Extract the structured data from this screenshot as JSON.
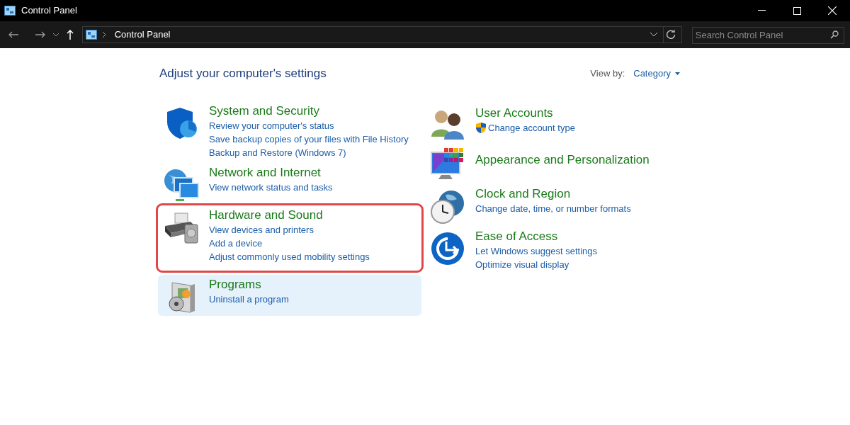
{
  "window": {
    "title": "Control Panel"
  },
  "address_bar": {
    "path": "Control Panel"
  },
  "search": {
    "placeholder": "Search Control Panel"
  },
  "heading": "Adjust your computer's settings",
  "view_by": {
    "label": "View by:",
    "value": "Category"
  },
  "columns": [
    {
      "categories": [
        {
          "kind": "security",
          "title": "System and Security",
          "highlighted": false,
          "hovered": false,
          "links": [
            {
              "text": "Review your computer's status"
            },
            {
              "text": "Save backup copies of your files with File History"
            },
            {
              "text": "Backup and Restore (Windows 7)"
            }
          ]
        },
        {
          "kind": "network",
          "title": "Network and Internet",
          "highlighted": false,
          "hovered": false,
          "links": [
            {
              "text": "View network status and tasks"
            }
          ]
        },
        {
          "kind": "hardware",
          "title": "Hardware and Sound",
          "highlighted": true,
          "hovered": false,
          "links": [
            {
              "text": "View devices and printers"
            },
            {
              "text": "Add a device"
            },
            {
              "text": "Adjust commonly used mobility settings"
            }
          ]
        },
        {
          "kind": "programs",
          "title": "Programs",
          "highlighted": false,
          "hovered": true,
          "links": [
            {
              "text": "Uninstall a program"
            }
          ]
        }
      ]
    },
    {
      "categories": [
        {
          "kind": "users",
          "title": "User Accounts",
          "highlighted": false,
          "hovered": false,
          "links": [
            {
              "text": "Change account type",
              "shield": true
            }
          ]
        },
        {
          "kind": "appearance",
          "title": "Appearance and Personalization",
          "highlighted": false,
          "hovered": false
        },
        {
          "kind": "clock",
          "title": "Clock and Region",
          "highlighted": false,
          "hovered": false,
          "links": [
            {
              "text": "Change date, time, or number formats"
            }
          ]
        },
        {
          "kind": "ease",
          "title": "Ease of Access",
          "highlighted": false,
          "hovered": false,
          "links": [
            {
              "text": "Let Windows suggest settings"
            },
            {
              "text": "Optimize visual display"
            }
          ]
        }
      ]
    }
  ]
}
